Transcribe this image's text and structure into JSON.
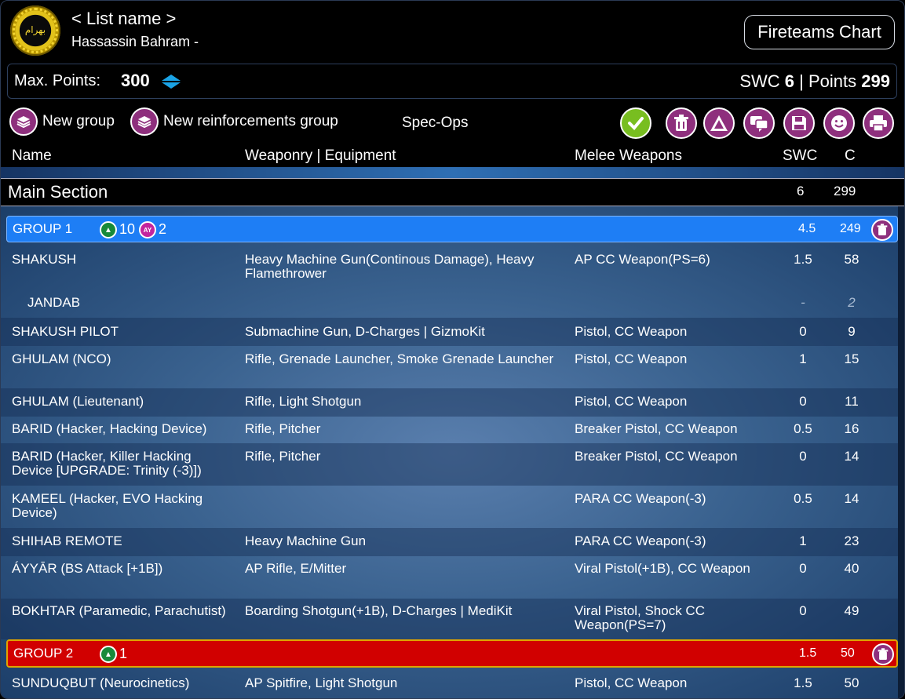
{
  "header": {
    "logo_text": "بهرام",
    "list_name": "< List name >",
    "army_name": "Hassassin Bahram -",
    "fireteams_button": "Fireteams Chart"
  },
  "points": {
    "max_label": "Max. Points:",
    "max_value": "300",
    "swc_label": "SWC",
    "swc_value": "6",
    "separator": "|",
    "points_label": "Points",
    "points_value": "299"
  },
  "toolbar": {
    "new_group": "New group",
    "new_reinforcements_group": "New reinforcements group",
    "spec_ops": "Spec-Ops",
    "actions": [
      {
        "name": "validate-icon",
        "color": "#78be20"
      },
      {
        "name": "trash-icon",
        "color": "#8e2f7d"
      },
      {
        "name": "warning-icon",
        "color": "#8e2f7d"
      },
      {
        "name": "chat-icon",
        "color": "#8e2f7d"
      },
      {
        "name": "save-icon",
        "color": "#8e2f7d"
      },
      {
        "name": "smiley-icon",
        "color": "#8e2f7d"
      },
      {
        "name": "print-icon",
        "color": "#8e2f7d"
      }
    ]
  },
  "columns": {
    "name": "Name",
    "weaponry": "Weaponry | Equipment",
    "melee": "Melee Weapons",
    "swc": "SWC",
    "c": "C"
  },
  "main_section": {
    "title": "Main Section",
    "swc": "6",
    "points": "299"
  },
  "groups": [
    {
      "name": "GROUP 1",
      "color": "#1e7ef5",
      "regular_count": "10",
      "irregular_count": "2",
      "swc": "4.5",
      "points": "249",
      "units": [
        {
          "name": "SHAKUSH",
          "weapons": "Heavy Machine Gun(Continous Damage), Heavy Flamethrower",
          "melee": "AP CC Weapon(PS=6)",
          "swc": "1.5",
          "points": "58"
        },
        {
          "name": "JANDAB",
          "weapons": "",
          "melee": "",
          "swc": "-",
          "points": "2"
        },
        {
          "name": "SHAKUSH PILOT",
          "weapons": "Submachine Gun, D-Charges | GizmoKit",
          "melee": "Pistol, CC Weapon",
          "swc": "0",
          "points": "9"
        },
        {
          "name": "GHULAM (NCO)",
          "weapons": "Rifle, Grenade Launcher, Smoke Grenade Launcher",
          "melee": "Pistol, CC Weapon",
          "swc": "1",
          "points": "15"
        },
        {
          "name": "GHULAM (Lieutenant)",
          "weapons": "Rifle, Light Shotgun",
          "melee": "Pistol, CC Weapon",
          "swc": "0",
          "points": "11"
        },
        {
          "name": "BARID (Hacker, Hacking Device)",
          "weapons": "Rifle, Pitcher",
          "melee": "Breaker Pistol, CC Weapon",
          "swc": "0.5",
          "points": "16"
        },
        {
          "name": "BARID (Hacker, Killer Hacking Device [UPGRADE: Trinity (-3)])",
          "weapons": "Rifle, Pitcher",
          "melee": "Breaker Pistol, CC Weapon",
          "swc": "0",
          "points": "14"
        },
        {
          "name": "KAMEEL (Hacker, EVO Hacking Device)",
          "weapons": "",
          "melee": "PARA CC Weapon(-3)",
          "swc": "0.5",
          "points": "14"
        },
        {
          "name": "SHIHAB REMOTE",
          "weapons": "Heavy Machine Gun",
          "melee": "PARA CC Weapon(-3)",
          "swc": "1",
          "points": "23"
        },
        {
          "name": "ÁYYĀR (BS Attack [+1B])",
          "weapons": "AP Rifle, E/Mitter",
          "melee": "Viral Pistol(+1B), CC Weapon",
          "swc": "0",
          "points": "40"
        },
        {
          "name": "BOKHTAR (Paramedic, Parachutist)",
          "weapons": "Boarding Shotgun(+1B), D-Charges | MediKit",
          "melee": "Viral Pistol, Shock CC Weapon(PS=7)",
          "swc": "0",
          "points": "49"
        }
      ]
    },
    {
      "name": "GROUP 2",
      "color": "#d10000",
      "regular_count": "1",
      "swc": "1.5",
      "points": "50",
      "units": [
        {
          "name": "SUNDUQBUT (Neurocinetics)",
          "weapons": "AP Spitfire, Light Shotgun",
          "melee": "Pistol, CC Weapon",
          "swc": "1.5",
          "points": "50"
        }
      ]
    }
  ]
}
